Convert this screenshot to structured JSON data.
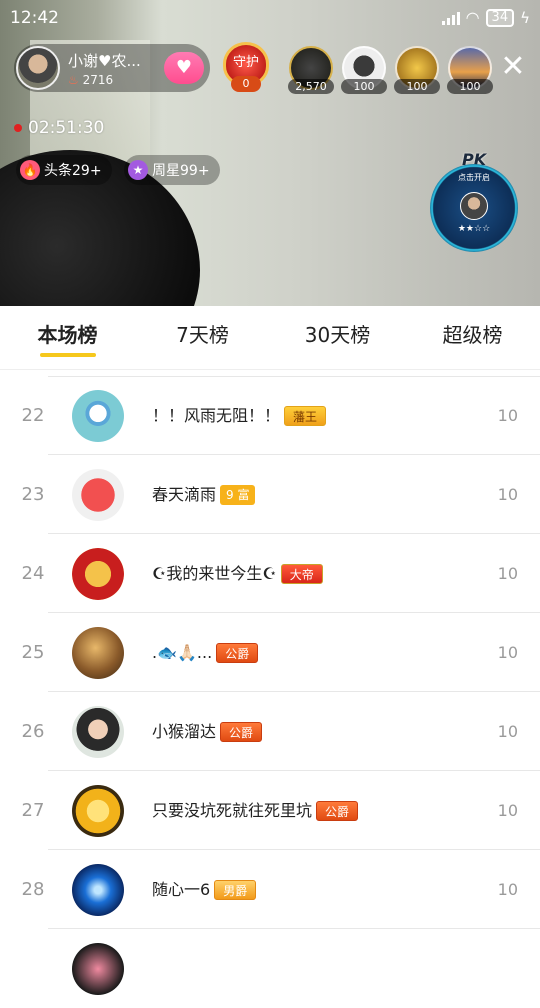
{
  "status": {
    "time": "12:42",
    "battery": "34"
  },
  "host": {
    "name": "小谢♥农...",
    "fans": "2716"
  },
  "guard": {
    "label": "守护",
    "count": "0"
  },
  "viewers": [
    {
      "count": "2,570",
      "color": "#2a2a22"
    },
    {
      "count": "100",
      "color": "#6d6d6d"
    },
    {
      "count": "100",
      "color": "#b8861a"
    },
    {
      "count": "100",
      "color": "#3a4a78"
    }
  ],
  "live": {
    "duration": "02:51:30"
  },
  "badges": {
    "headline": "头条29+",
    "weekly_star": "周星99+"
  },
  "pk": {
    "label": "PK",
    "hint": "点击开启",
    "stars": "★★☆☆"
  },
  "tabs": [
    "本场榜",
    "7天榜",
    "30天榜",
    "超级榜"
  ],
  "active_tab": 0,
  "ranking": [
    {
      "rank": "22",
      "name": "！！风雨无阻！！",
      "badge": "藩王",
      "badge_style": "gold",
      "score": "10",
      "avatar_color": "#7ccbd4"
    },
    {
      "rank": "23",
      "name": "春天滴雨",
      "badge": "9 富",
      "badge_style": "rich",
      "score": "10",
      "avatar_color": "#f25050"
    },
    {
      "rank": "24",
      "name": "☪我的来世今生☪",
      "badge": "大帝",
      "badge_style": "red",
      "score": "10",
      "avatar_color": "#c81e1e"
    },
    {
      "rank": "25",
      "name": ".🐟🙏🏻...",
      "badge": "公爵",
      "badge_style": "orange",
      "score": "10",
      "avatar_color": "#9b6a2e"
    },
    {
      "rank": "26",
      "name": "小猴溜达",
      "badge": "公爵",
      "badge_style": "orange",
      "score": "10",
      "avatar_color": "#3b3b3b"
    },
    {
      "rank": "27",
      "name": "只要没坑死就往死里坑",
      "badge": "公爵",
      "badge_style": "orange",
      "score": "10",
      "avatar_color": "#f2b21a"
    },
    {
      "rank": "28",
      "name": "随心一6",
      "badge": "男爵",
      "badge_style": "yellow",
      "score": "10",
      "avatar_color": "#1a6fd6"
    }
  ]
}
